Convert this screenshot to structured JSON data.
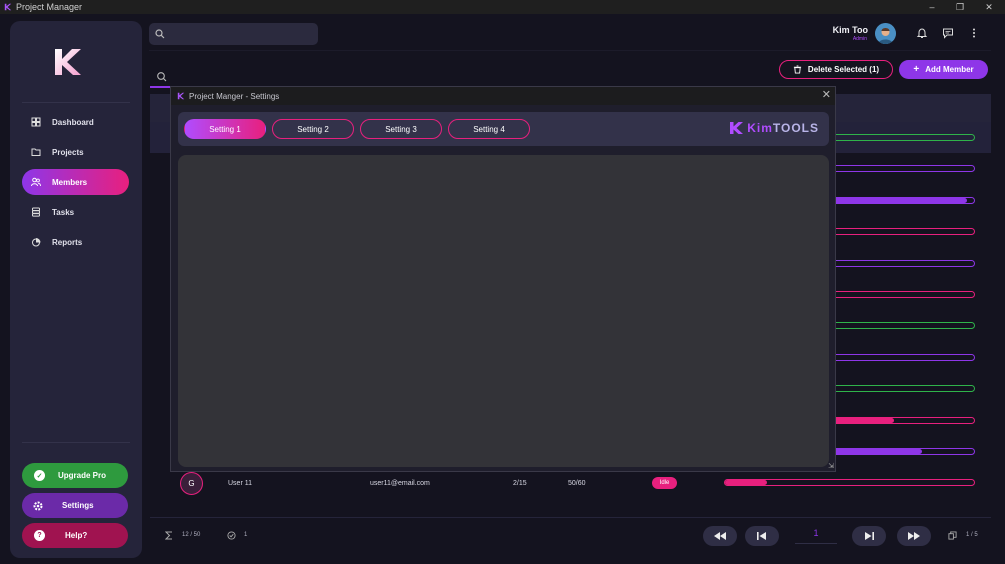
{
  "window": {
    "title": "Project Manager"
  },
  "sidebar": {
    "items": [
      {
        "label": "Dashboard",
        "icon": "dashboard-icon"
      },
      {
        "label": "Projects",
        "icon": "folder-icon"
      },
      {
        "label": "Members",
        "icon": "users-icon"
      },
      {
        "label": "Tasks",
        "icon": "tasks-icon"
      },
      {
        "label": "Reports",
        "icon": "chart-icon"
      }
    ],
    "active": "Members",
    "upgrade_label": "Upgrade Pro",
    "settings_label": "Settings",
    "help_label": "Help?"
  },
  "search": {
    "placeholder": ""
  },
  "user": {
    "name": "Kim Too",
    "role": "Admin"
  },
  "toolbar": {
    "delete_label": "Delete Selected (1)",
    "add_label": "Add Member"
  },
  "table": {
    "progress_bars": [
      {
        "fraction": 0.0,
        "color": "#2fb34a"
      },
      {
        "fraction": 0.0,
        "color": "#8e36e8"
      },
      {
        "fraction": 0.97,
        "color": "#8e36e8"
      },
      {
        "fraction": 0.02,
        "color": "#e8207e"
      },
      {
        "fraction": 0.0,
        "color": "#8e36e8"
      },
      {
        "fraction": 0.01,
        "color": "#e8207e"
      },
      {
        "fraction": 0.05,
        "color": "#2fb34a"
      },
      {
        "fraction": 0.0,
        "color": "#8e36e8"
      },
      {
        "fraction": 0.0,
        "color": "#2fb34a"
      },
      {
        "fraction": 0.68,
        "color": "#e8207e"
      },
      {
        "fraction": 0.79,
        "color": "#8e36e8"
      },
      {
        "fraction": 0.17,
        "color": "#e8207e"
      }
    ],
    "last_row": {
      "initial": "G",
      "name": "User 11",
      "email": "user11@email.com",
      "tasks": "2/15",
      "hours": "50/60",
      "status": "Idle"
    }
  },
  "footer": {
    "count": "12 / 50",
    "selected": "1",
    "page_input": "1",
    "pages": "1 / 5"
  },
  "dialog": {
    "title": "Project Manger  - Settings",
    "tabs": [
      "Setting 1",
      "Setting 2",
      "Setting 3",
      "Setting 4"
    ],
    "brand_kim": "Kim",
    "brand_tools": "TOOLS"
  },
  "colors": {
    "accent_purple": "#8e36e8",
    "accent_pink": "#e8207e",
    "accent_green": "#2fb34a"
  }
}
